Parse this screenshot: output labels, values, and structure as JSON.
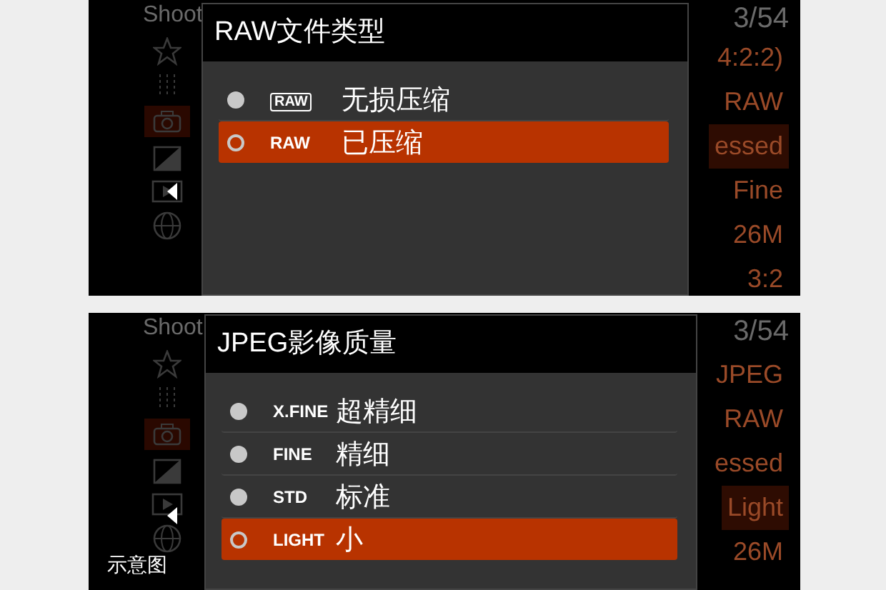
{
  "screens": [
    {
      "menu": {
        "title": "Shoot",
        "page": "3/54",
        "values": [
          {
            "text": "4:2:2)",
            "selected": false
          },
          {
            "text": "RAW",
            "selected": false
          },
          {
            "text": "essed",
            "selected": true
          },
          {
            "text": "Fine",
            "selected": false
          },
          {
            "text": "26M",
            "selected": false
          },
          {
            "text": "3:2",
            "selected": false
          }
        ]
      },
      "dialog": {
        "title": "RAW文件类型",
        "options": [
          {
            "kind": "boxed",
            "badge": "RAW",
            "label": "无损压缩",
            "selected": false
          },
          {
            "kind": "plain",
            "badge": "RAW",
            "label": "已压缩",
            "selected": true
          }
        ]
      }
    },
    {
      "menu": {
        "title": "Shoot",
        "page": "3/54",
        "values": [
          {
            "text": "JPEG",
            "selected": false
          },
          {
            "text": "RAW",
            "selected": false
          },
          {
            "text": "essed",
            "selected": false
          },
          {
            "text": "Light",
            "selected": true
          },
          {
            "text": "26M",
            "selected": false
          }
        ]
      },
      "dialog": {
        "title": "JPEG影像质量",
        "options": [
          {
            "kind": "plain",
            "badge": "X.FINE",
            "label": "超精细",
            "selected": false
          },
          {
            "kind": "plain",
            "badge": "FINE",
            "label": "精细",
            "selected": false
          },
          {
            "kind": "plain",
            "badge": "STD",
            "label": "标准",
            "selected": false
          },
          {
            "kind": "plain",
            "badge": "LIGHT",
            "label": "小",
            "selected": true
          }
        ]
      },
      "caption": "示意图"
    }
  ]
}
